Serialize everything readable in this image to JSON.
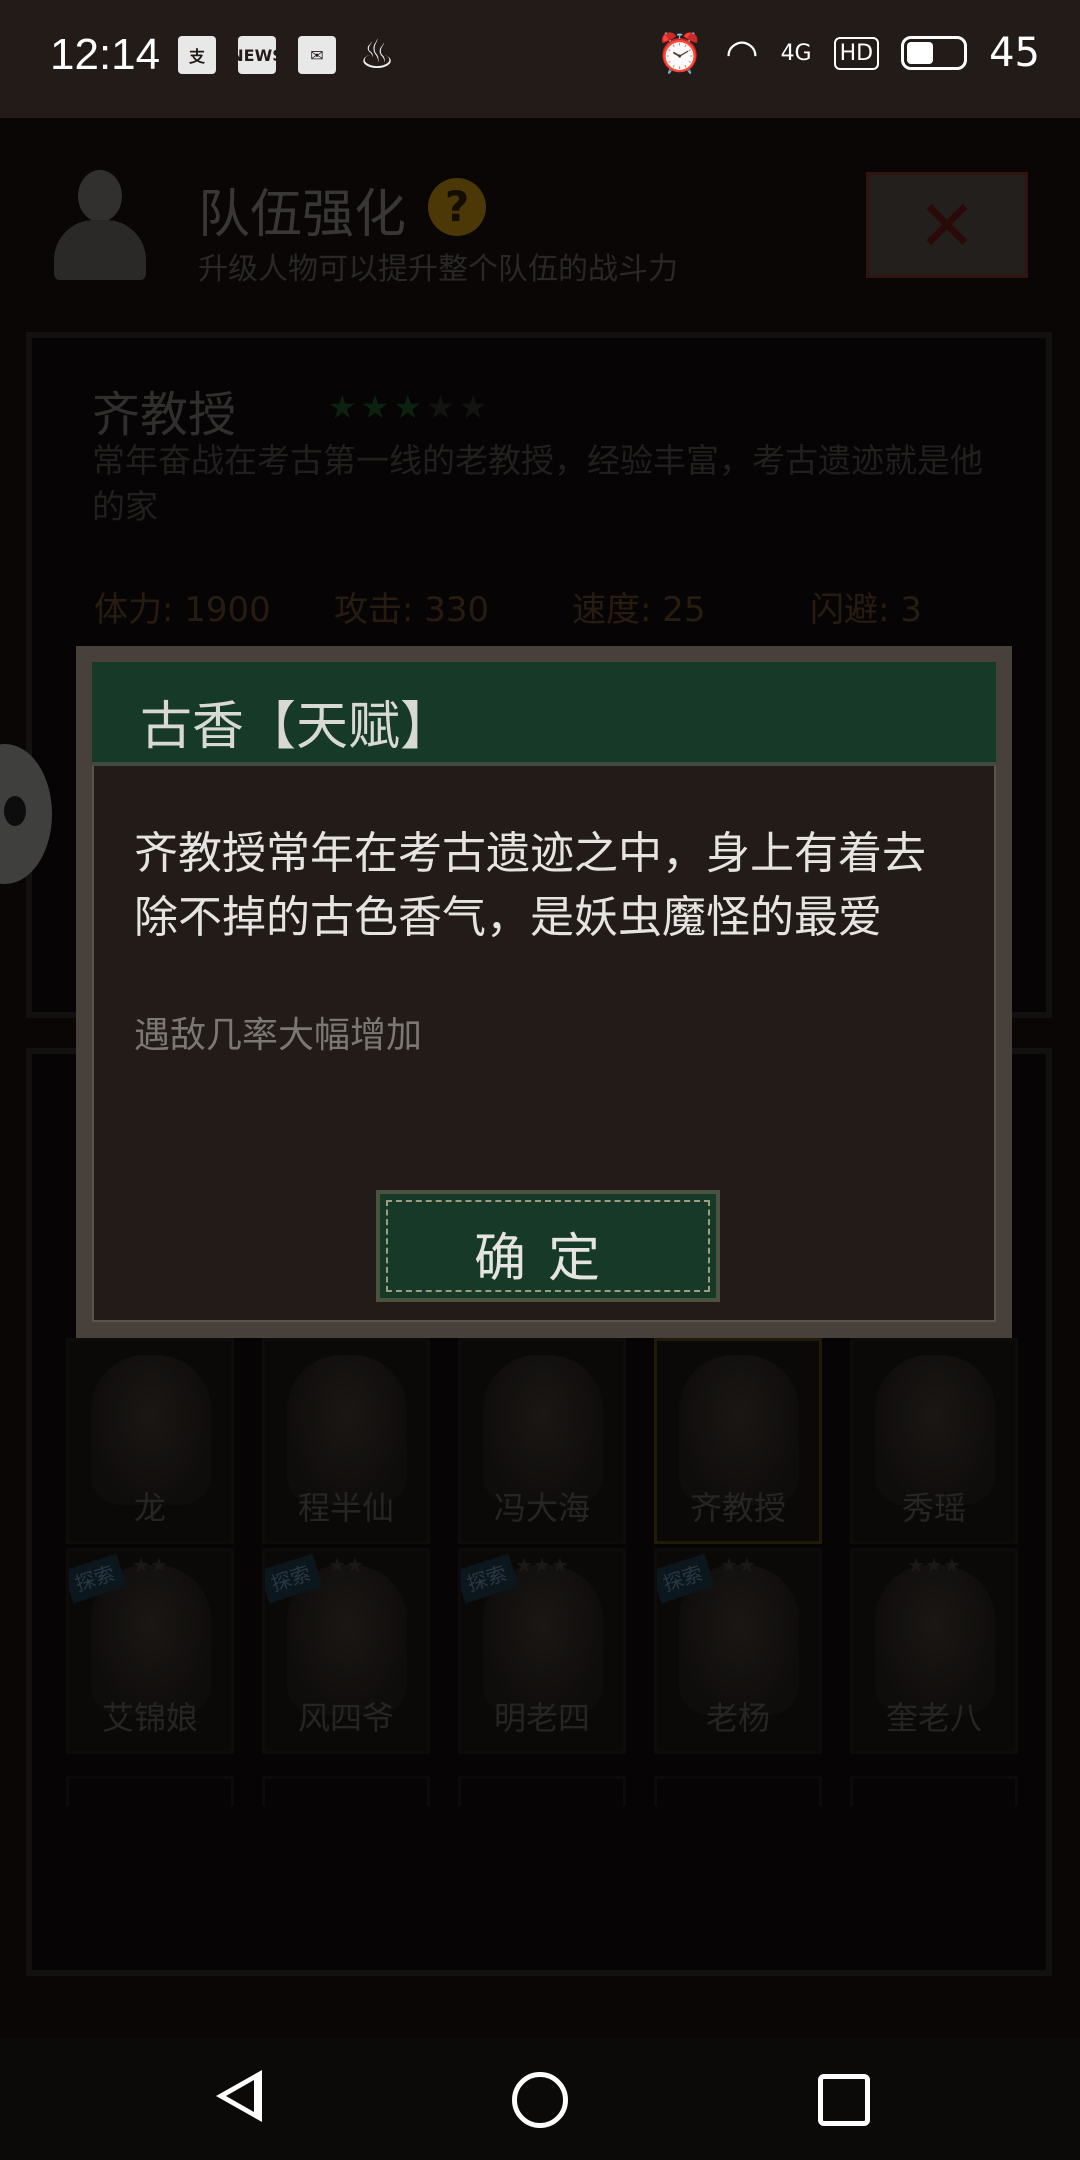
{
  "status_bar": {
    "time": "12:14",
    "left_icons": [
      "alipay-icon",
      "news-icon",
      "mail-icon",
      "flame-icon"
    ],
    "news_label": "NEWS",
    "right_icons": [
      "alarm-icon",
      "wifi-icon",
      "signal-4g-icon",
      "hd-icon",
      "battery-icon"
    ],
    "net_label": "4G",
    "hd_label": "HD",
    "battery": "45"
  },
  "header": {
    "title": "队伍强化",
    "help": "?",
    "subtitle": "升级人物可以提升整个队伍的战斗力",
    "close": "✕"
  },
  "character": {
    "name": "齐教授",
    "stars_filled": 3,
    "stars_total": 5,
    "description": "常年奋战在考古第一线的老教授，经验丰富，考古遗迹就是他的家",
    "stats": {
      "hp": "体力: 1900",
      "attack": "攻击: 330",
      "speed": "速度: 25",
      "dodge": "闪避: 3"
    }
  },
  "roster": {
    "row1": [
      "龙",
      "程半仙",
      "冯大海",
      "齐教授",
      "秀瑶"
    ],
    "row2": [
      "艾锦娘",
      "风四爷",
      "明老四",
      "老杨",
      "奎老八"
    ],
    "explore_tag": "探索",
    "row2_stars": [
      "★★",
      "★★",
      "★★★",
      "★★",
      "★★★"
    ],
    "selected": "齐教授"
  },
  "modal": {
    "title": "古香【天赋】",
    "text": "齐教授常年在考古遗迹之中，身上有着去除不掉的古色香气，是妖虫魔怪的最爱",
    "effect": "遇敌几率大幅增加",
    "confirm": "确定"
  },
  "colors": {
    "modal_header": "#173a28",
    "modal_body": "#231b18",
    "help_badge": "#a87c10",
    "star_active": "#1d4a22"
  }
}
